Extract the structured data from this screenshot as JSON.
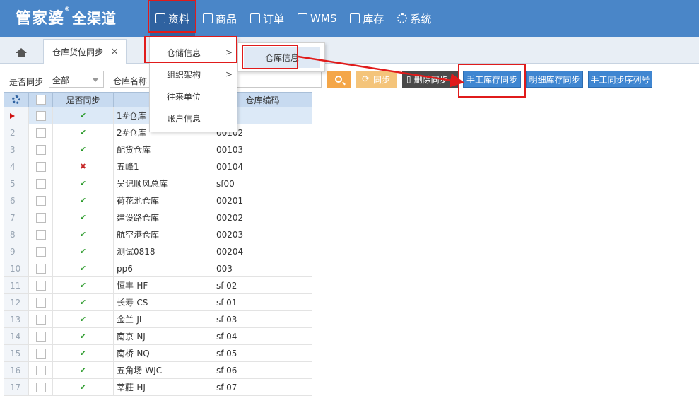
{
  "app": {
    "logo_main": "管家婆",
    "logo_reg": "®",
    "logo_sub": "全渠道"
  },
  "nav": [
    {
      "label": "资料",
      "icon": "list-icon",
      "active": true
    },
    {
      "label": "商品",
      "icon": "box-icon"
    },
    {
      "label": "订单",
      "icon": "document-icon"
    },
    {
      "label": "WMS",
      "icon": "home-icon"
    },
    {
      "label": "库存",
      "icon": "stack-icon"
    },
    {
      "label": "系统",
      "icon": "gear-icon"
    }
  ],
  "tabs": {
    "active_label": "仓库货位同步",
    "close": "×"
  },
  "filters": {
    "sync_label": "是否同步",
    "sync_value": "全部",
    "warehouse_label": "仓库名称"
  },
  "buttons": {
    "sync": "同步",
    "delete_sync": "删除同步",
    "manual_stock_sync": "手工库存同步",
    "detail_stock_sync": "明细库存同步",
    "manual_serial_sync": "手工同步序列号"
  },
  "menu": {
    "items": [
      {
        "label": "仓储信息",
        "has_sub": true
      },
      {
        "label": "组织架构",
        "has_sub": true
      },
      {
        "label": "往来单位",
        "has_sub": false
      },
      {
        "label": "账户信息",
        "has_sub": false
      }
    ],
    "submenu": {
      "label": "仓库信息"
    },
    "chev": ">"
  },
  "grid": {
    "headers": {
      "sync": "是否同步",
      "name": "仓库名称",
      "code": "仓库编码"
    },
    "header_name_visible": "仓",
    "rows": [
      {
        "no": "",
        "synced": true,
        "name": "1#仓库",
        "code": ""
      },
      {
        "no": "2",
        "synced": true,
        "name": "2#仓库",
        "code": "00102"
      },
      {
        "no": "3",
        "synced": true,
        "name": "配货仓库",
        "code": "00103"
      },
      {
        "no": "4",
        "synced": false,
        "name": "五峰1",
        "code": "00104"
      },
      {
        "no": "5",
        "synced": true,
        "name": "吴记顺风总库",
        "code": "sf00"
      },
      {
        "no": "6",
        "synced": true,
        "name": "荷花池仓库",
        "code": "00201"
      },
      {
        "no": "7",
        "synced": true,
        "name": "建设路仓库",
        "code": "00202"
      },
      {
        "no": "8",
        "synced": true,
        "name": "航空港仓库",
        "code": "00203"
      },
      {
        "no": "9",
        "synced": true,
        "name": "测试0818",
        "code": "00204"
      },
      {
        "no": "10",
        "synced": true,
        "name": "pp6",
        "code": "003"
      },
      {
        "no": "11",
        "synced": true,
        "name": "恒丰-HF",
        "code": "sf-02"
      },
      {
        "no": "12",
        "synced": true,
        "name": "长寿-CS",
        "code": "sf-01"
      },
      {
        "no": "13",
        "synced": true,
        "name": "金兰-JL",
        "code": "sf-03"
      },
      {
        "no": "14",
        "synced": true,
        "name": "南京-NJ",
        "code": "sf-04"
      },
      {
        "no": "15",
        "synced": true,
        "name": "南桥-NQ",
        "code": "sf-05"
      },
      {
        "no": "16",
        "synced": true,
        "name": "五角场-WJC",
        "code": "sf-06"
      },
      {
        "no": "17",
        "synced": true,
        "name": "莘莊-HJ",
        "code": "sf-07"
      }
    ],
    "check_mark": "✔",
    "cross_mark": "✖"
  },
  "colors": {
    "topbar": "#4a86c8",
    "nav_active": "#2f62a0",
    "highlight": "#e01b1b",
    "button_blue": "#3f86d1"
  }
}
